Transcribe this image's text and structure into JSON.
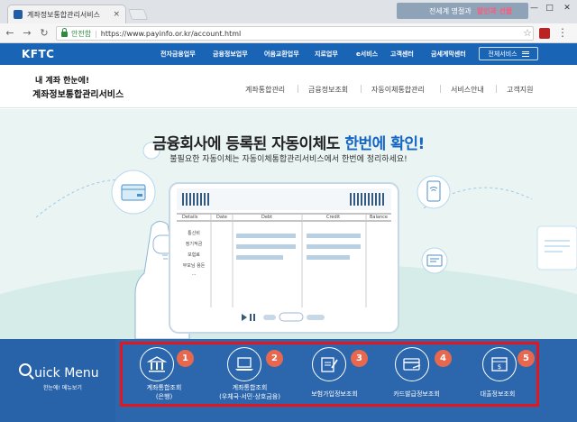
{
  "browser": {
    "tab_title": "계좌정보통합관리서비스",
    "tab_close": "×",
    "ad_text": "전세계 명절과",
    "ad_highlight": "할인과 선물",
    "secure_label": "안전함",
    "url": "https://www.payinfo.or.kr/account.html"
  },
  "site": {
    "logo": "KFTC",
    "top_nav": [
      "전자금융업무",
      "금융정보업무",
      "어음교환업무",
      "지로업무",
      "e서비스",
      "고객센터",
      "금세계막센터"
    ],
    "all_services": "전체서비스"
  },
  "service": {
    "brand_line1": "내 계좌 한눈에!",
    "brand_line2": "계좌정보통합관리서비스",
    "sub_nav": [
      "계좌통합관리",
      "금융정보조회",
      "자동이체통합관리",
      "서비스안내",
      "고객지원"
    ]
  },
  "hero": {
    "title_part1": "금융회사에 등록된 자동이체도 ",
    "title_part2": "한번에 확인!",
    "subtitle": "불필요한 자동이체는 자동이체통합관리서비스에서 한번에 정리하세요!",
    "table_headers": [
      "Details",
      "Date",
      "Debt",
      "Credit",
      "Balance"
    ],
    "table_rows": [
      "통신비",
      "정기적금",
      "보험료",
      "부모님 용돈",
      "..."
    ]
  },
  "quick_menu": {
    "title_q": "Q",
    "title_rest": "uick Menu",
    "subtitle": "한눈에! 메뉴보기",
    "items": [
      {
        "badge": "1",
        "label_line1": "계좌통합조회",
        "label_line2": "(은행)",
        "icon": "bank-icon"
      },
      {
        "badge": "2",
        "label_line1": "계좌통합조회",
        "label_line2": "(우체국·서민·상호금융)",
        "icon": "laptop-icon"
      },
      {
        "badge": "3",
        "label_line1": "보험가입정보조회",
        "label_line2": "",
        "icon": "insurance-icon"
      },
      {
        "badge": "4",
        "label_line1": "카드발급정보조회",
        "label_line2": "",
        "icon": "card-icon"
      },
      {
        "badge": "5",
        "label_line1": "대출정보조회",
        "label_line2": "",
        "icon": "loan-icon"
      }
    ]
  },
  "colors": {
    "brand_blue": "#1a64b6",
    "quick_blue": "#2c67ae",
    "hero_bg": "#e9f4f3",
    "badge": "#e8684f",
    "highlight_box": "#e4161b"
  }
}
